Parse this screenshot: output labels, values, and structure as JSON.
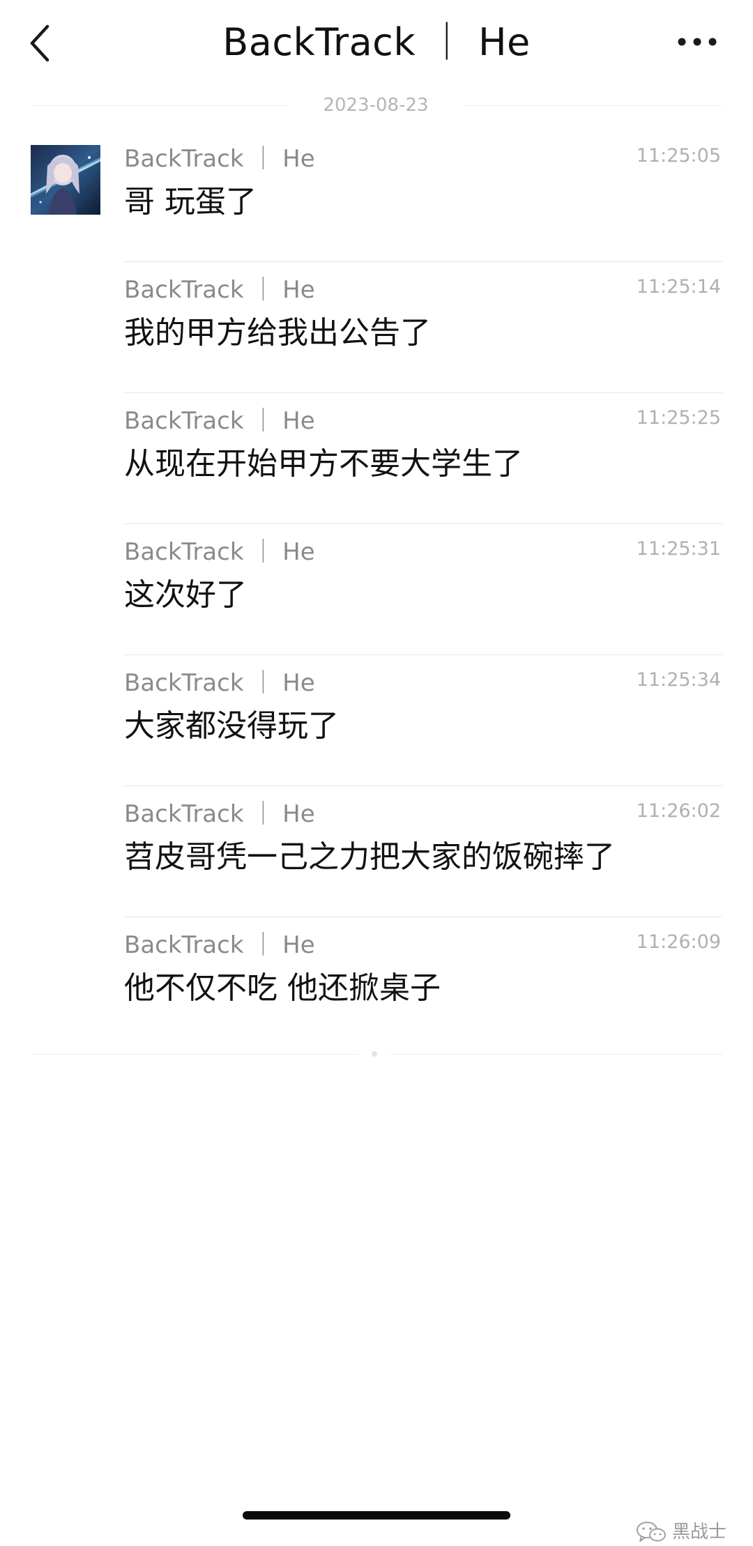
{
  "header": {
    "title": "BackTrack ｜ He",
    "back_icon": "chevron-left-icon",
    "more_icon": "more-horizontal-icon"
  },
  "date_separator": "2023-08-23",
  "messages": [
    {
      "sender": "BackTrack ｜ He",
      "time": "11:25:05",
      "text": "哥 玩蛋了"
    },
    {
      "sender": "BackTrack ｜ He",
      "time": "11:25:14",
      "text": "我的甲方给我出公告了"
    },
    {
      "sender": "BackTrack ｜ He",
      "time": "11:25:25",
      "text": "从现在开始甲方不要大学生了"
    },
    {
      "sender": "BackTrack ｜ He",
      "time": "11:25:31",
      "text": "这次好了"
    },
    {
      "sender": "BackTrack ｜ He",
      "time": "11:25:34",
      "text": "大家都没得玩了"
    },
    {
      "sender": "BackTrack ｜ He",
      "time": "11:26:02",
      "text": "苕皮哥凭一己之力把大家的饭碗摔了"
    },
    {
      "sender": "BackTrack ｜ He",
      "time": "11:26:09",
      "text": "他不仅不吃 他还掀桌子"
    }
  ],
  "watermark": {
    "text": "黑战士",
    "icon": "wechat-icon"
  },
  "colors": {
    "title": "#111111",
    "sender": "#8a8a8a",
    "timestamp": "#b0b0b0",
    "divider": "#e6e6e6",
    "date": "#b5b5b5"
  }
}
